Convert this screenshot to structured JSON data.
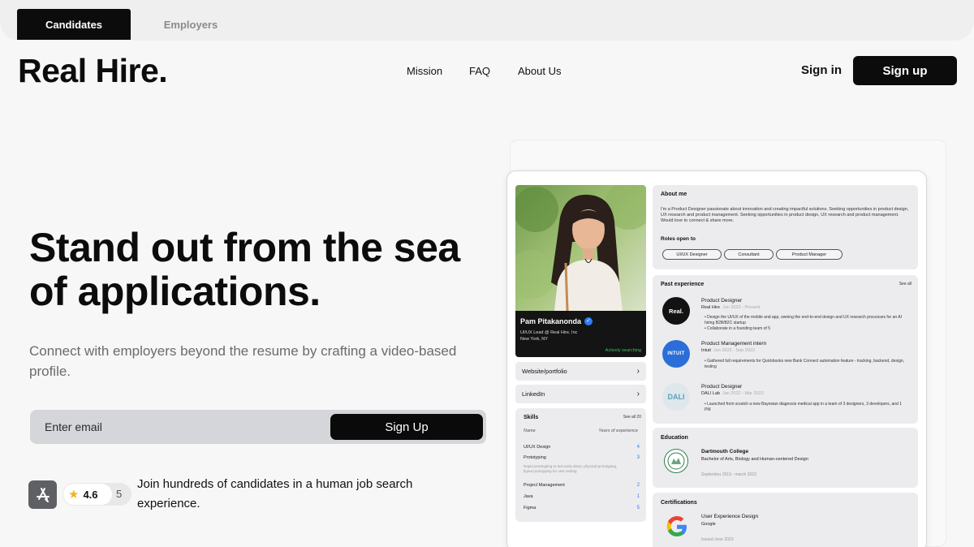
{
  "tabs": {
    "candidates": "Candidates",
    "employers": "Employers"
  },
  "header": {
    "logo": "Real Hire.",
    "nav": [
      "Mission",
      "FAQ",
      "About Us"
    ],
    "sign_in": "Sign in",
    "sign_up": "Sign up"
  },
  "hero": {
    "title": "Stand out from the sea of applications.",
    "subtitle": "Connect with employers beyond the resume by crafting a video-based profile.",
    "email_placeholder": "Enter email",
    "signup_button": "Sign Up",
    "rating_value": "4.6",
    "rating_count": "5",
    "join_text": "Join hundreds of candidates in a human job search experience."
  },
  "profile": {
    "name": "Pam Pitakanonda",
    "role": "UI/UX Lead @ Real Hire, Inc",
    "location": "New York, NY",
    "status": "Actively searching",
    "links": [
      "Website/portfolio",
      "LinkedIn"
    ],
    "skills": {
      "title": "Skills",
      "see_all": "See all 20",
      "col_name": "Name",
      "col_years": "Years of experience",
      "items": [
        {
          "name": "UI/UX Design",
          "years": "4"
        },
        {
          "name": "Prototyping",
          "years": "3",
          "note": "Rapid prototyping to test early ideas, physical prototyping, figma prototyping for user testing"
        },
        {
          "name": "Project Management",
          "years": "2"
        },
        {
          "name": "Java",
          "years": "1"
        },
        {
          "name": "Figma",
          "years": "5"
        }
      ]
    },
    "about": {
      "title": "About me",
      "text": "I'm a Product Designer passionate about innovation and creating impactful solutions. Seeking opportunities in product design, UX research and product management. Seeking opportunities in product design, UX research and product management. Would love to connect & share more.",
      "roles_title": "Roles open to",
      "roles": [
        "UI/UX Designer",
        "Consultant",
        "Product Manager"
      ]
    },
    "experience": {
      "title": "Past experience",
      "see_all": "See all",
      "items": [
        {
          "logo": "Real.",
          "title": "Product Designer",
          "company": "Real Hire",
          "dates": "Jun 2023 - Present",
          "bullets": [
            "Design the UI/UX of the mobile and app, owning the end-to-end design and UX research processes for an AI hiring B2B/B2C startup",
            "Collaborate in a founding team of 5"
          ]
        },
        {
          "logo": "INTUIT",
          "title": "Product Management intern",
          "company": "Intuit",
          "dates": "Jun 2022 - Sep 2022",
          "bullets": [
            "Gathered full requirements for Quickbooks new Bank Connect automation feature - tracking, backend, design, testing"
          ]
        },
        {
          "logo": "DALI",
          "title": "Product Designer",
          "company": "DALI Lab",
          "dates": "Jan 2022 - Mar 2023",
          "bullets": [
            "Launched from scratch a new Bayesian diagnosis medical app in a team of 3 designers, 3 developers, and 1 PM"
          ]
        }
      ]
    },
    "education": {
      "title": "Education",
      "school": "Dartmouth College",
      "degree": "Bachelor of Arts, Biology and Human-centered Design",
      "dates": "September 2019 - march 2023"
    },
    "certifications": {
      "title": "Certifications",
      "name": "User Experience Design",
      "issuer": "Google",
      "date": "Issued June 2023"
    }
  },
  "colors": {
    "accent": "#0c0c0c",
    "verified": "#2f7df6",
    "active": "#3fbf5f",
    "star": "#f2b41d"
  }
}
